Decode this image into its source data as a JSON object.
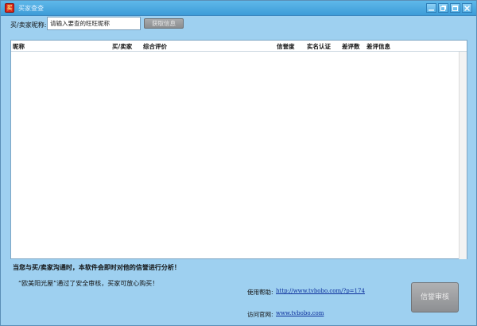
{
  "window": {
    "title": "买家查查",
    "app_icon_text": "买",
    "controls": [
      "minimize-icon",
      "restore-icon",
      "maximize-icon",
      "close-icon"
    ]
  },
  "search": {
    "label": "买/卖家昵称:",
    "value": "请输入要查的旺旺昵称",
    "button_label": "获取信息"
  },
  "table": {
    "columns": [
      "昵称",
      "买/卖家",
      "综合评价",
      "信誉度",
      "实名认证",
      "差评数",
      "差评信息"
    ],
    "rows": []
  },
  "footer": {
    "analysis_note": "当您与买/卖家沟通时，本软件会即时对他的信誉进行分析！",
    "store_note": "“欧美阳光屋”通过了安全审核，买家可放心购买！",
    "help_label": "使用帮助:",
    "help_url": "http://www.tvbobo.com/?p=174",
    "site_label": "访问官网:",
    "site_url": "www.tvbobo.com",
    "credit_button_label": "信誉审核"
  },
  "colors": {
    "window_bg": "#9ed0f0",
    "titlebar": "#3d9cd8",
    "disabled_button": "#8b8d8f",
    "link": "#0b2e9c"
  }
}
